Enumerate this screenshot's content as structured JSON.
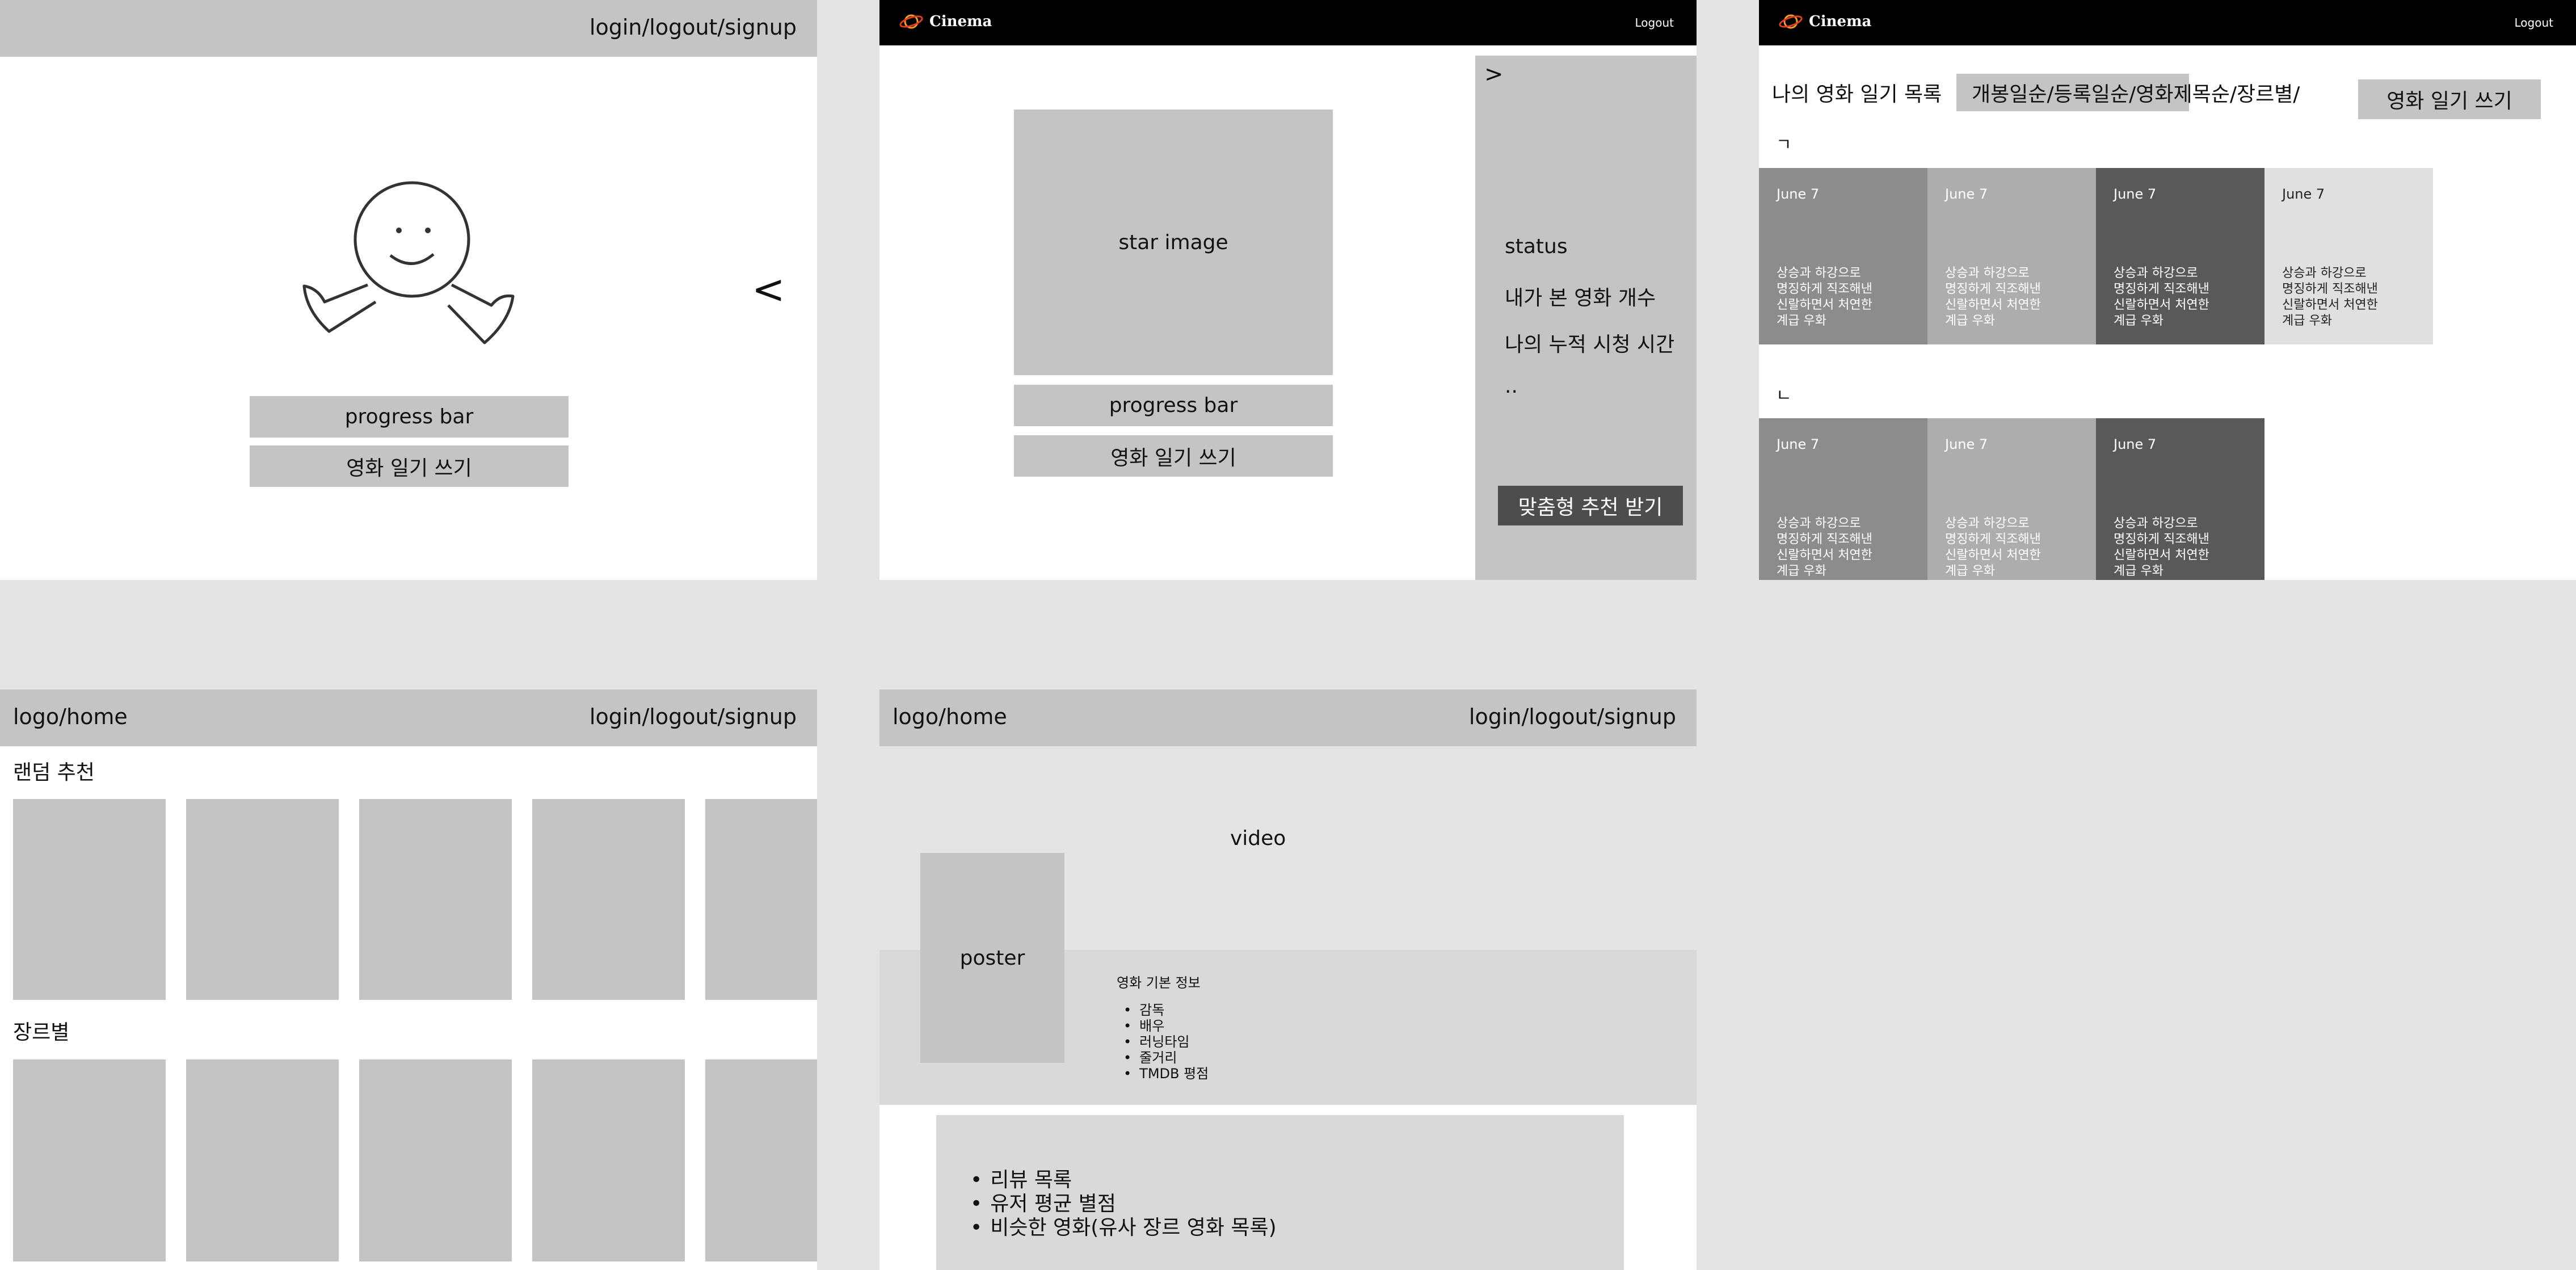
{
  "frame1": {
    "header_right": "login/logout/signup",
    "progress_label": "progress bar",
    "diary_button": "영화 일기 쓰기",
    "collapse_glyph": "<"
  },
  "frame2": {
    "logo_text": "Cinema",
    "logout": "Logout",
    "star_image_label": "star image",
    "progress_label": "progress bar",
    "diary_button": "영화 일기 쓰기",
    "expand_glyph": ">",
    "panel_items": [
      "status",
      "내가 본 영화 개수",
      "나의 누적 시청 시간",
      ".."
    ],
    "recommend_button": "맞춤형 추천 받기"
  },
  "frame3": {
    "logo_text": "Cinema",
    "logout": "Logout",
    "list_title": "나의 영화 일기 목록",
    "sort_options": "개봉일순/등록일순/영화제목순/장르별/",
    "write_button": "영화 일기 쓰기",
    "section_a": "ㄱ",
    "section_b": "ㄴ",
    "cards_row1": [
      {
        "date": "June 7",
        "desc": "상승과 하강으로 명징하게 직조해낸 신랄하면서 처연한 계급 우화",
        "color": "#8c8c8c"
      },
      {
        "date": "June 7",
        "desc": "상승과 하강으로 명징하게 직조해낸 신랄하면서 처연한 계급 우화",
        "color": "#adadad"
      },
      {
        "date": "June 7",
        "desc": "상승과 하강으로 명징하게 직조해낸 신랄하면서 처연한 계급 우화",
        "color": "#595959"
      },
      {
        "date": "June 7",
        "desc": "상승과 하강으로 명징하게 직조해낸 신랄하면서 처연한 계급 우화",
        "color": "#e0e0e0"
      }
    ],
    "cards_row2": [
      {
        "date": "June 7",
        "desc": "상승과 하강으로 명징하게 직조해낸 신랄하면서 처연한 계급 우화",
        "color": "#8c8c8c"
      },
      {
        "date": "June 7",
        "desc": "상승과 하강으로 명징하게 직조해낸 신랄하면서 처연한 계급 우화",
        "color": "#adadad"
      },
      {
        "date": "June 7",
        "desc": "상승과 하강으로 명징하게 직조해낸 신랄하면서 처연한 계급 우화",
        "color": "#595959"
      }
    ]
  },
  "frame4": {
    "header_left": "logo/home",
    "header_right": "login/logout/signup",
    "section_random": "랜덤 추천",
    "section_genre": "장르별"
  },
  "frame5": {
    "header_left": "logo/home",
    "header_right": "login/logout/signup",
    "video_label": "video",
    "poster_label": "poster",
    "info_title": "영화 기본 정보",
    "info_items": [
      "감독",
      "배우",
      "러닝타임",
      "줄거리",
      "TMDB 평점"
    ],
    "bottom_items": [
      "리뷰 목록",
      "유저 평균 별점",
      "비슷한 영화(유사 장르 영화 목록)"
    ]
  }
}
